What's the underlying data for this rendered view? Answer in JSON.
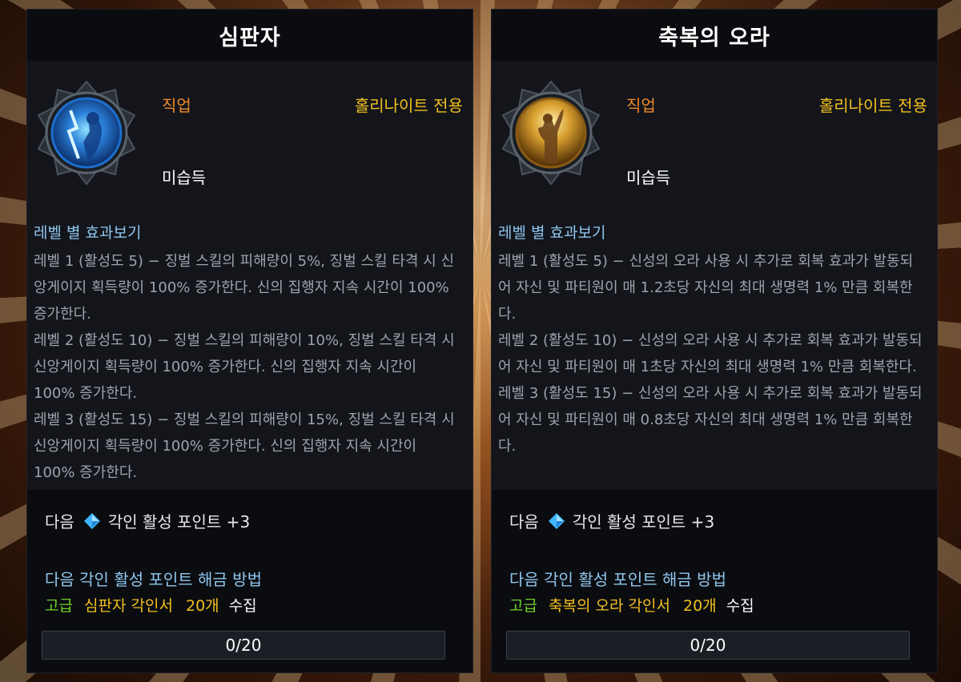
{
  "colors": {
    "job_label": "#f08a2a",
    "class_label": "#f2c01e",
    "effects_header": "#8fc7ee",
    "effects_text": "#9ea3ab",
    "grade_green": "#6ed32a",
    "item_gold": "#f2c01e"
  },
  "panels": [
    {
      "title": "심판자",
      "icon": "judgment-skill-icon",
      "job_label": "직업",
      "class_label": "홀리나이트 전용",
      "status": "미습득",
      "effects_header": "레벨 별 효과보기",
      "effects": [
        "레벨 1 (활성도 5) − 징벌 스킬의 피해량이 5%, 징벌 스킬 타격 시 신앙게이지 획득량이 100% 증가한다. 신의 집행자 지속 시간이 100% 증가한다.",
        "레벨 2 (활성도 10) − 징벌 스킬의 피해량이 10%, 징벌 스킬 타격 시 신앙게이지 획득량이 100% 증가한다. 신의 집행자 지속 시간이 100% 증가한다.",
        "레벨 3 (활성도 15) − 징벌 스킬의 피해량이 15%, 징벌 스킬 타격 시 신앙게이지 획득량이 100% 증가한다. 신의 집행자 지속 시간이 100% 증가한다."
      ],
      "next_label": "다음",
      "next_points": "각인 활성 포인트 +3",
      "unlock_title": "다음 각인 활성 포인트 해금 방법",
      "unlock_grade": "고급",
      "unlock_item": "심판자 각인서",
      "unlock_count": "20개",
      "unlock_action": "수집",
      "progress_text": "0/20",
      "progress_value": 0
    },
    {
      "title": "축복의 오라",
      "icon": "blessing-aura-skill-icon",
      "job_label": "직업",
      "class_label": "홀리나이트 전용",
      "status": "미습득",
      "effects_header": "레벨 별 효과보기",
      "effects": [
        "레벨 1 (활성도 5) − 신성의 오라 사용 시 추가로 회복 효과가 발동되어 자신 및 파티원이 매 1.2초당 자신의 최대 생명력 1% 만큼 회복한다.",
        "레벨 2 (활성도 10) − 신성의 오라 사용 시 추가로 회복 효과가 발동되어 자신 및 파티원이 매 1초당 자신의 최대 생명력 1% 만큼 회복한다.",
        "레벨 3 (활성도 15) − 신성의 오라 사용 시 추가로 회복 효과가 발동되어 자신 및 파티원이 매 0.8초당 자신의 최대 생명력 1% 만큼 회복한다."
      ],
      "next_label": "다음",
      "next_points": "각인 활성 포인트 +3",
      "unlock_title": "다음 각인 활성 포인트 해금 방법",
      "unlock_grade": "고급",
      "unlock_item": "축복의 오라 각인서",
      "unlock_count": "20개",
      "unlock_action": "수집",
      "progress_text": "0/20",
      "progress_value": 0
    }
  ]
}
